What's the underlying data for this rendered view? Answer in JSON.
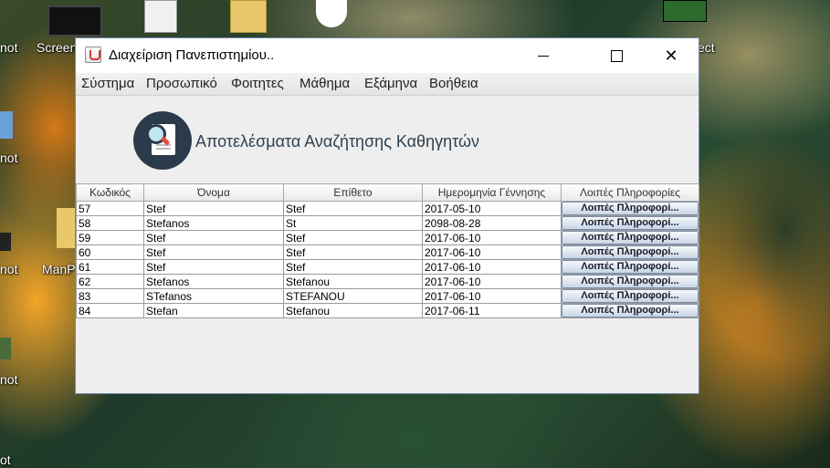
{
  "desktop": {
    "labels": [
      "not",
      "Screen",
      "not",
      "not",
      "ManP",
      "not",
      "ect",
      "ot"
    ]
  },
  "window": {
    "title": "Διαχείριση Πανεπιστημίου..",
    "controls": {
      "minimize": "minimize-icon",
      "maximize": "maximize-icon",
      "close": "✕"
    }
  },
  "menu": [
    "Σύστημα",
    "Προσωπικό",
    "Φοιτητες",
    "Μάθημα",
    "Εξάμηνα",
    "Βοήθεια"
  ],
  "header": {
    "title": "Αποτελέσματα Αναζήτησης Καθηγητών",
    "icon": "document-search-icon"
  },
  "table": {
    "columns": [
      "Κωδικός",
      "Όνομα",
      "Επίθετο",
      "Ημερομηνία Γέννησης",
      "Λοιπές Πληροφορίες"
    ],
    "button_label": "Λοιπές Πληροφορί...",
    "rows": [
      [
        "57",
        "Stef",
        "Stef",
        "2017-05-10"
      ],
      [
        "58",
        "Stefanos",
        "St",
        "2098-08-28"
      ],
      [
        "59",
        "Stef",
        "Stef",
        "2017-06-10"
      ],
      [
        "60",
        "Stef",
        "Stef",
        "2017-06-10"
      ],
      [
        "61",
        "Stef",
        "Stef",
        "2017-06-10"
      ],
      [
        "62",
        "Stefanos",
        "Stefanou",
        "2017-06-10"
      ],
      [
        "83",
        "STefanos",
        "STEFANOU",
        "2017-06-10"
      ],
      [
        "84",
        "Stefan",
        "Stefanou",
        "2017-06-11"
      ]
    ]
  }
}
